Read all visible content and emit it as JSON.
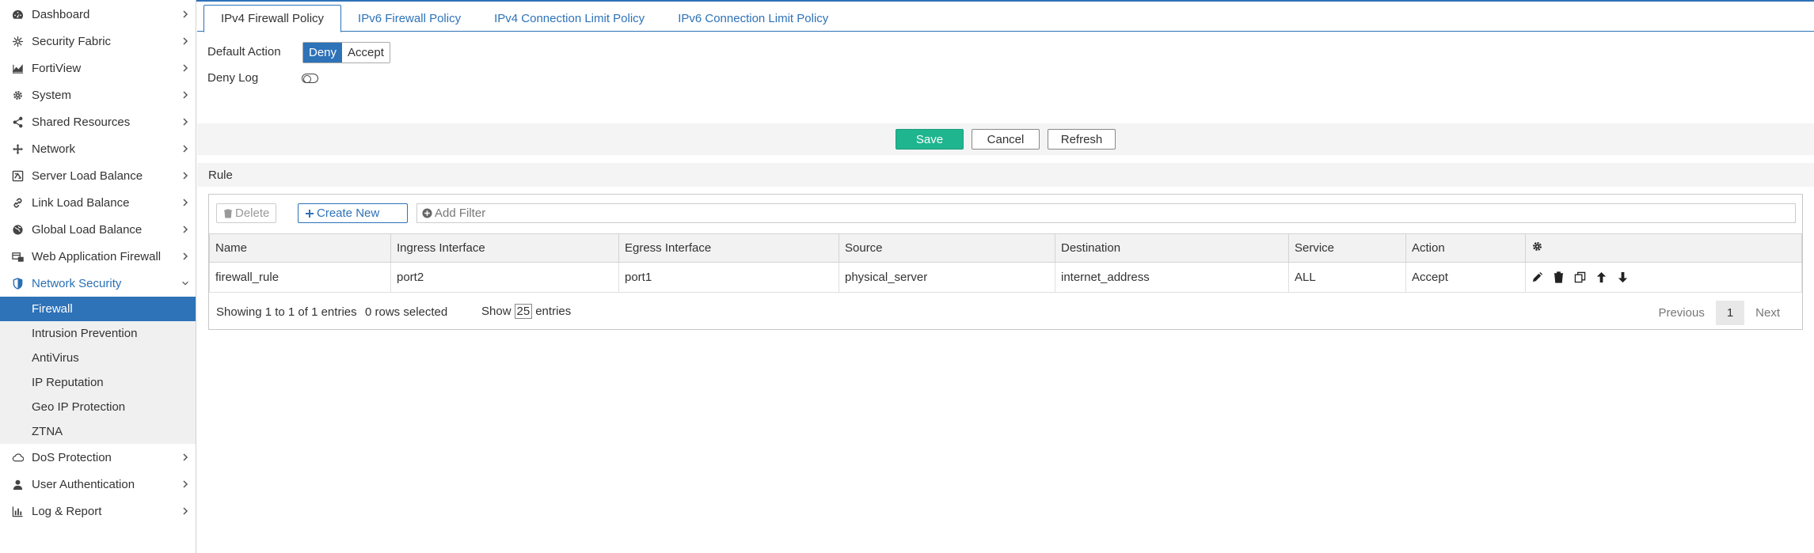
{
  "sidebar": {
    "items": [
      {
        "label": "Dashboard",
        "icon": "dashboard-icon"
      },
      {
        "label": "Security Fabric",
        "icon": "security-fabric-icon"
      },
      {
        "label": "FortiView",
        "icon": "chart-icon"
      },
      {
        "label": "System",
        "icon": "gear-icon"
      },
      {
        "label": "Shared Resources",
        "icon": "share-icon"
      },
      {
        "label": "Network",
        "icon": "network-icon"
      },
      {
        "label": "Server Load Balance",
        "icon": "server-load-balance-icon"
      },
      {
        "label": "Link Load Balance",
        "icon": "link-icon"
      },
      {
        "label": "Global Load Balance",
        "icon": "globe-icon"
      },
      {
        "label": "Web Application Firewall",
        "icon": "waf-icon"
      },
      {
        "label": "Network Security",
        "icon": "shield-icon"
      }
    ],
    "sub_items": [
      "Firewall",
      "Intrusion Prevention",
      "AntiVirus",
      "IP Reputation",
      "Geo IP Protection",
      "ZTNA"
    ],
    "items_after": [
      {
        "label": "DoS Protection",
        "icon": "cloud-icon"
      },
      {
        "label": "User Authentication",
        "icon": "user-icon"
      },
      {
        "label": "Log & Report",
        "icon": "bar-chart-icon"
      }
    ]
  },
  "tabs": [
    "IPv4 Firewall Policy",
    "IPv6 Firewall Policy",
    "IPv4 Connection Limit Policy",
    "IPv6 Connection Limit Policy"
  ],
  "settings": {
    "default_action_label": "Default Action",
    "deny_label": "Deny",
    "accept_label": "Accept",
    "deny_log_label": "Deny Log"
  },
  "actions": {
    "save": "Save",
    "cancel": "Cancel",
    "refresh": "Refresh"
  },
  "rule": {
    "header": "Rule",
    "delete_label": "Delete",
    "create_label": "Create New",
    "filter_placeholder": "Add Filter",
    "columns": [
      "Name",
      "Ingress Interface",
      "Egress Interface",
      "Source",
      "Destination",
      "Service",
      "Action"
    ],
    "rows": [
      {
        "name": "firewall_rule",
        "ingress": "port2",
        "egress": "port1",
        "source": "physical_server",
        "destination": "internet_address",
        "service": "ALL",
        "action": "Accept"
      }
    ],
    "footer": {
      "showing": "Showing 1 to 1 of 1 entries",
      "selected": "0 rows selected",
      "show_label": "Show",
      "page_size": "25",
      "entries_label": "entries",
      "previous": "Previous",
      "page": "1",
      "next": "Next"
    }
  },
  "colors": {
    "accent": "#2e72b8",
    "save": "#1fb58f"
  }
}
